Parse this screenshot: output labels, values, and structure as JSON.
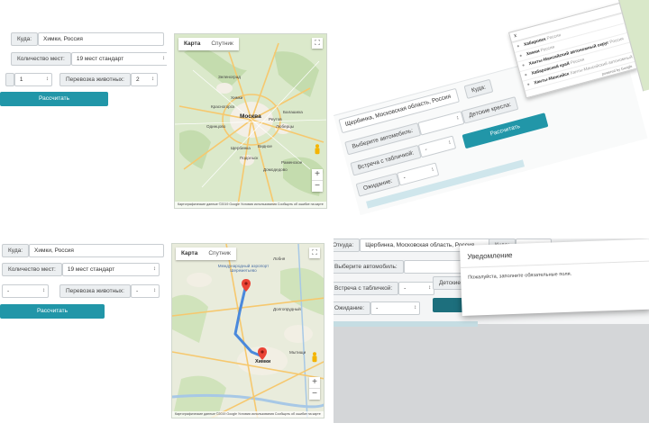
{
  "p1": {
    "to_label": "Куда:",
    "to_value": "Химки, Россия",
    "seats_label": "Количество мест:",
    "seats_value": "19 мест стандарт",
    "qty_value": "1",
    "animals_label": "Перевозка животных:",
    "animals_value": "2",
    "calc_button": "Рассчитать"
  },
  "map1": {
    "tab_map": "Карта",
    "tab_sat": "Спутник",
    "cities": [
      "Зеленоград",
      "Химки",
      "Москва",
      "Люберцы",
      "Подольск",
      "Балашиха",
      "Одинцово",
      "Красногорск",
      "Реутов",
      "Видное",
      "Щербинка",
      "Раменское",
      "Домодедово"
    ],
    "footer": "Картографические данные ©2019 Google   Условия использования   Сообщить об ошибке на карте"
  },
  "p2": {
    "from_value": "Щербинка, Московская область, Россия",
    "to_label": "Куда:",
    "select_label": "Выберите автомобиль:",
    "meet_label": "Встреча с табличкой:",
    "meet_value": "-",
    "child_label": "Детские кресла:",
    "wait_label": "Ожидание:",
    "wait_value": "-",
    "calc_button": "Рассчитать",
    "dropdown_input": "х",
    "dropdown": [
      {
        "bold": "Хабаровск",
        "rest": "Россия"
      },
      {
        "bold": "Химки",
        "rest": "Россия"
      },
      {
        "bold": "Ханты-Мансийский автономный округ",
        "rest": "Россия"
      },
      {
        "bold": "Хабаровский край",
        "rest": "Россия"
      },
      {
        "bold": "Ханты-Мансийск",
        "rest": "Ханты-Мансийский автономный округ"
      }
    ],
    "powered": "powered by Google"
  },
  "p3": {
    "to_label": "Куда:",
    "to_value": "Химки, Россия",
    "seats_label": "Количество мест:",
    "seats_value": "19 мест стандарт",
    "qty_value": "-",
    "animals_label": "Перевозка животных:",
    "animals_value": "-",
    "calc_button": "Рассчитать"
  },
  "map2": {
    "tab_map": "Карта",
    "tab_sat": "Спутник",
    "airport": "Международный аэропорт Шереметьево",
    "cities": [
      "Химки",
      "Долгопрудный",
      "Лобня",
      "Мытищи"
    ],
    "footer": "Картографические данные ©2019 Google   Условия использования   Сообщить об ошибке на карте"
  },
  "p4": {
    "from_label": "Откуда:",
    "from_value": "Щербинка, Московская область, Россия",
    "to_label": "Куда:",
    "select_label": "Выберите автомобиль:",
    "meet_label": "Встреча с табличкой:",
    "meet_value": "-",
    "child_label": "Детские кре",
    "wait_label": "Ожидание:",
    "wait_value": "-",
    "modal_title": "Уведомление",
    "modal_text": "Пожалуйста, заполните обязательные поля."
  }
}
